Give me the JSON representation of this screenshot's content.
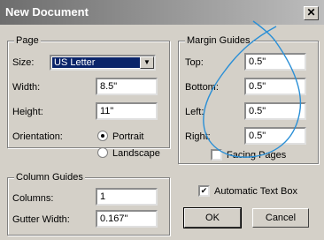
{
  "window": {
    "title": "New Document",
    "close_glyph": "✕"
  },
  "page": {
    "legend": "Page",
    "size_label": "Size:",
    "size_value": "US Letter",
    "width_label": "Width:",
    "width_value": "8.5\"",
    "height_label": "Height:",
    "height_value": "11\"",
    "orientation_label": "Orientation:",
    "orientation_options": [
      "Portrait",
      "Landscape"
    ],
    "orientation_selected": "Portrait"
  },
  "margins": {
    "legend": "Margin Guides",
    "top_label": "Top:",
    "top_value": "0.5\"",
    "bottom_label": "Bottom:",
    "bottom_value": "0.5\"",
    "left_label": "Left:",
    "left_value": "0.5\"",
    "right_label": "Right:",
    "right_value": "0.5\"",
    "facing_pages_label": "Facing Pages",
    "facing_pages_checked": false
  },
  "columns": {
    "legend": "Column Guides",
    "columns_label": "Columns:",
    "columns_value": "1",
    "gutter_label": "Gutter Width:",
    "gutter_value": "0.167\""
  },
  "options": {
    "auto_text_box_label": "Automatic Text Box",
    "auto_text_box_checked": true
  },
  "buttons": {
    "ok": "OK",
    "cancel": "Cancel"
  },
  "colors": {
    "annotation_stroke": "#2a8fd6",
    "title_bar_start": "#6d6d6d",
    "selection": "#0a246a"
  }
}
